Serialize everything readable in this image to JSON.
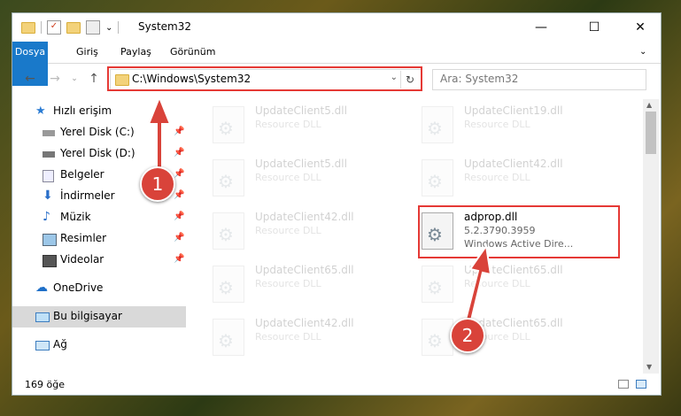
{
  "window": {
    "title": "System32",
    "controls": {
      "minimize": "—",
      "maximize": "☐",
      "close": "✕"
    }
  },
  "menu": {
    "items": [
      "Dosya",
      "Giriş",
      "Paylaş",
      "Görünüm"
    ]
  },
  "nav": {
    "back": "←",
    "forward": "→",
    "up": "↑",
    "dropdown": "⌄",
    "expand": "⌄"
  },
  "address": {
    "path": "C:\\Windows\\System32",
    "refresh": "↻",
    "chevron": "⌄"
  },
  "search": {
    "placeholder": "Ara: System32"
  },
  "sidebar": {
    "items": [
      {
        "label": "Hızlı erişim",
        "icon": "star-icon"
      },
      {
        "label": "Yerel Disk (C:)",
        "icon": "drive-icon"
      },
      {
        "label": "Yerel Disk (D:)",
        "icon": "drive-icon"
      },
      {
        "label": "Belgeler",
        "icon": "documents-icon"
      },
      {
        "label": "İndirmeler",
        "icon": "download-icon"
      },
      {
        "label": "Müzik",
        "icon": "music-icon"
      },
      {
        "label": "Resimler",
        "icon": "pictures-icon"
      },
      {
        "label": "Videolar",
        "icon": "videos-icon"
      },
      {
        "label": "OneDrive",
        "icon": "cloud-icon"
      },
      {
        "label": "Bu bilgisayar",
        "icon": "computer-icon"
      },
      {
        "label": "Ağ",
        "icon": "network-icon"
      }
    ]
  },
  "files": {
    "left": [
      {
        "name": "UpdateClient5.dll",
        "type": "Resource DLL"
      },
      {
        "name": "UpdateClient5.dll",
        "type": "Resource DLL"
      },
      {
        "name": "UpdateClient42.dll",
        "type": "Resource DLL"
      },
      {
        "name": "UpdateClient65.dll",
        "type": "Resource DLL"
      },
      {
        "name": "UpdateClient42.dll",
        "type": "Resource DLL"
      }
    ],
    "right": [
      {
        "name": "UpdateClient19.dll",
        "type": "Resource DLL"
      },
      {
        "name": "UpdateClient42.dll",
        "type": "Resource DLL"
      },
      {
        "name": "adprop.dll",
        "version": "5.2.3790.3959",
        "desc": "Windows Active Dire..."
      },
      {
        "name": "UpdateClient65.dll",
        "type": "Resource DLL"
      },
      {
        "name": "UpdateClient65.dll",
        "type": "Resource DLL"
      }
    ]
  },
  "status": {
    "count": "169 öğe"
  },
  "annotations": {
    "step1": "1",
    "step2": "2"
  },
  "colors": {
    "accent": "#1979ca",
    "highlight": "#e53935",
    "badge": "#d9433a"
  }
}
